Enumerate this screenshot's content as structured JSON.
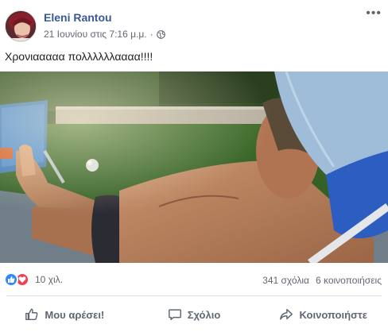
{
  "post": {
    "author": "Eleni Rantou",
    "timestamp": "21 Ιουνίου στις 7:16 μ.μ.",
    "separator": "·",
    "privacy_icon": "globe-icon",
    "more_icon": "more-options-icon",
    "more_glyph": "•••",
    "text": "Χρονιααααα πολλλλλλαααα!!!!"
  },
  "stats": {
    "reaction_icons": [
      "like-reaction-icon",
      "love-reaction-icon"
    ],
    "reaction_count": "10 χιλ.",
    "comments": "341 σχόλια",
    "shares": "6 κοινοποιήσεις"
  },
  "actions": {
    "like_label": "Μου αρέσει!",
    "comment_label": "Σχόλιο",
    "share_label": "Κοινοποιήστε"
  },
  "colors": {
    "author_link": "#385898",
    "secondary_text": "#606770",
    "like_blue": "#2d88ff",
    "love_red": "#f33e58"
  }
}
